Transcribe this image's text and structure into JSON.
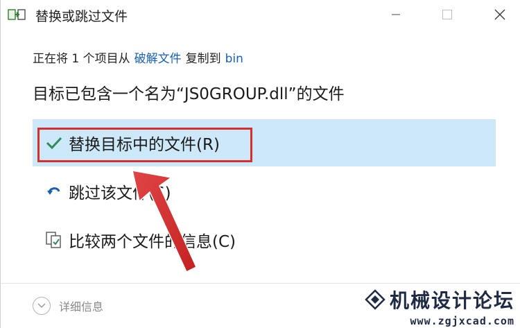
{
  "window": {
    "title": "替换或跳过文件",
    "title_icon": "file-transfer-icon",
    "controls": [
      "minimize-icon",
      "maximize-icon",
      "close-icon"
    ]
  },
  "info": {
    "prefix": "正在将 1 个项目从",
    "source": "破解文件",
    "middle": "复制到",
    "destination": "bin"
  },
  "message": "目标已包含一个名为“JS0GROUP.dll”的文件",
  "options": [
    {
      "label": "替换目标中的文件(R)",
      "icon": "check-icon",
      "selected": true
    },
    {
      "label": "跳过该文件(S)",
      "icon": "skip-arrow-icon",
      "selected": false
    },
    {
      "label": "比较两个文件的信息(C)",
      "icon": "compare-files-icon",
      "selected": false
    }
  ],
  "details": {
    "label": "详细信息",
    "icon": "chevron-down-icon"
  },
  "watermark": {
    "title": "机械设计论坛",
    "url": "www.zgjxcad.com"
  },
  "colors": {
    "selected_bg": "#cde8f8",
    "highlight_border": "#d62f2f",
    "link": "#1a5fb4",
    "check": "#2e8b57"
  }
}
